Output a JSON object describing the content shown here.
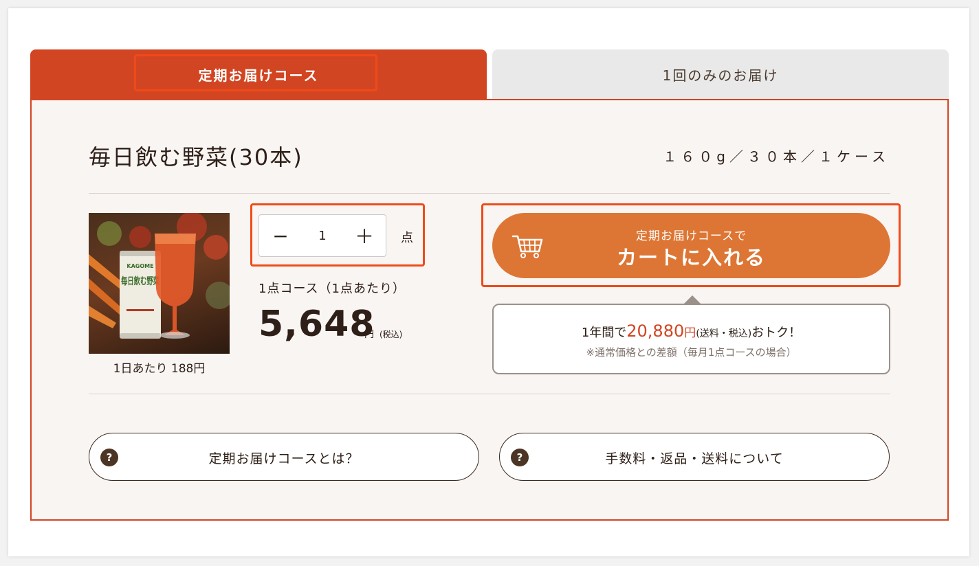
{
  "tabs": {
    "subscription": "定期お届けコース",
    "one_time": "1回のみのお届け"
  },
  "product": {
    "title": "毎日飲む野菜(30本)",
    "spec": "１６０g／３０本／１ケース",
    "image_brand": "KAGOME",
    "image_name": "毎日飲む野菜",
    "per_day": "1日あたり 188円"
  },
  "quantity": {
    "minus": "−",
    "value": "1",
    "plus": "＋",
    "unit": "点"
  },
  "pricing": {
    "course_label": "1点コース（1点あたり）",
    "price": "5,648",
    "currency": "円",
    "tax_note": "(税込)"
  },
  "cart_button": {
    "subtitle": "定期お届けコースで",
    "label": "カートに入れる"
  },
  "savings": {
    "prefix": "1年間で",
    "amount": "20,880",
    "unit": "円",
    "tax": "(送料・税込)",
    "suffix": "おトク！",
    "note": "※通常価格との差額（毎月1点コースの場合）"
  },
  "info_buttons": [
    {
      "label": "定期お届けコースとは？",
      "icon": "?"
    },
    {
      "label": "手数料・返品・送料について",
      "icon": "?"
    }
  ],
  "colors": {
    "accent": "#d24522",
    "cart": "#dd7634",
    "highlight": "#f04a18",
    "panel_bg": "#f9f5f3"
  }
}
